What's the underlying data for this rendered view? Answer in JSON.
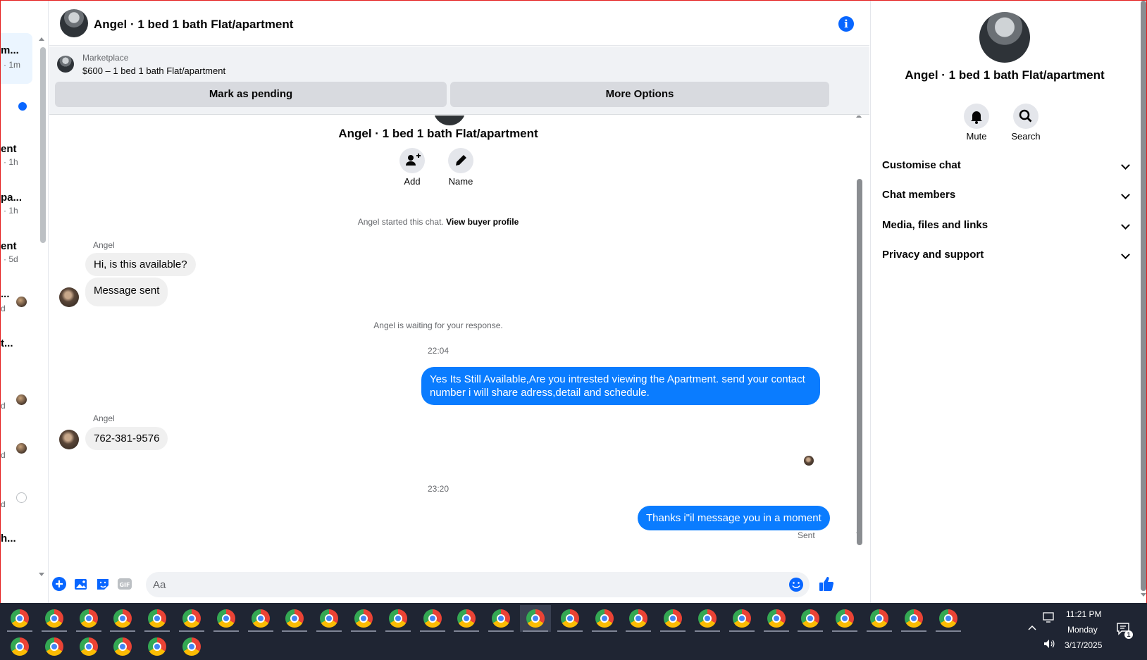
{
  "sidebar": {
    "items": [
      {
        "title": "m...",
        "time": "· 1m"
      },
      {
        "title": "ent",
        "time": "· 1h"
      },
      {
        "title": "pa...",
        "time": "· 1h"
      },
      {
        "title": "ent",
        "time": "· 5d"
      },
      {
        "title": "...",
        "time": "d"
      },
      {
        "title": "t...",
        "time": ""
      },
      {
        "title": "",
        "time": "d"
      },
      {
        "title": "",
        "time": "d"
      },
      {
        "title": "",
        "time": "d"
      },
      {
        "title": "h...",
        "time": ""
      }
    ]
  },
  "header": {
    "title": "Angel · 1 bed 1 bath Flat/apartment",
    "info_icon": "info-icon"
  },
  "marketplace": {
    "label": "Marketplace",
    "listing": "$600 – 1 bed 1 bath Flat/apartment",
    "mark_pending": "Mark as pending",
    "more_options": "More Options"
  },
  "chat": {
    "title": "Angel · 1 bed 1 bath Flat/apartment",
    "add_label": "Add",
    "name_label": "Name",
    "started_text": "Angel started this chat.",
    "buyer_link": "View buyer profile",
    "waiting_text": "Angel is waiting for your response.",
    "messages": [
      {
        "sender": "Angel",
        "text": "Hi, is this available?"
      },
      {
        "text": "Message sent"
      },
      {
        "time": "22:04"
      },
      {
        "text": "Yes Its Still Available,Are you intrested viewing the Apartment. send your contact number i will share adress,detail and schedule."
      },
      {
        "sender": "Angel",
        "text": "762-381-9576"
      },
      {
        "time": "23:20"
      },
      {
        "text": "Thanks i\"il message you in a moment",
        "status": "Sent"
      }
    ]
  },
  "composer": {
    "placeholder": "Aa"
  },
  "right_panel": {
    "name": "Angel · 1 bed 1 bath Flat/apartment",
    "mute_label": "Mute",
    "search_label": "Search",
    "sections": [
      "Customise chat",
      "Chat members",
      "Media, files and links",
      "Privacy and support"
    ]
  },
  "taskbar": {
    "time": "11:21 PM",
    "day": "Monday",
    "date": "3/17/2025",
    "notifications": "1"
  },
  "colors": {
    "accent": "#0866ff",
    "bubble_out": "#0a7cff",
    "bubble_in": "#f0f0f0",
    "taskbar": "#1f2533"
  }
}
